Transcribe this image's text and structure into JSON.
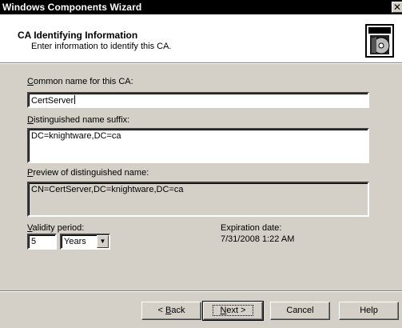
{
  "window": {
    "title": "Windows Components Wizard",
    "close_glyph": "✕"
  },
  "header": {
    "title": "CA Identifying Information",
    "subtitle": "Enter information to identify this CA.",
    "icon": "wizard-box-cd-icon"
  },
  "form": {
    "common_name": {
      "label_accel": "C",
      "label_rest": "ommon name for this CA:",
      "value": "CertServer"
    },
    "dn_suffix": {
      "label_accel": "D",
      "label_rest": "istinguished name suffix:",
      "value": "DC=knightware,DC=ca"
    },
    "preview": {
      "label_accel": "P",
      "label_rest": "review of distinguished name:",
      "value": "CN=CertServer,DC=knightware,DC=ca"
    },
    "validity": {
      "label_accel": "V",
      "label_rest": "alidity period:",
      "value": "5",
      "unit": "Years"
    },
    "expiration": {
      "label": "Expiration date:",
      "value": "7/31/2008 1:22 AM"
    }
  },
  "buttons": {
    "back": {
      "pre": "< ",
      "accel": "B",
      "rest": "ack"
    },
    "next": {
      "accel": "N",
      "rest": "ext >"
    },
    "cancel": "Cancel",
    "help": "Help"
  }
}
